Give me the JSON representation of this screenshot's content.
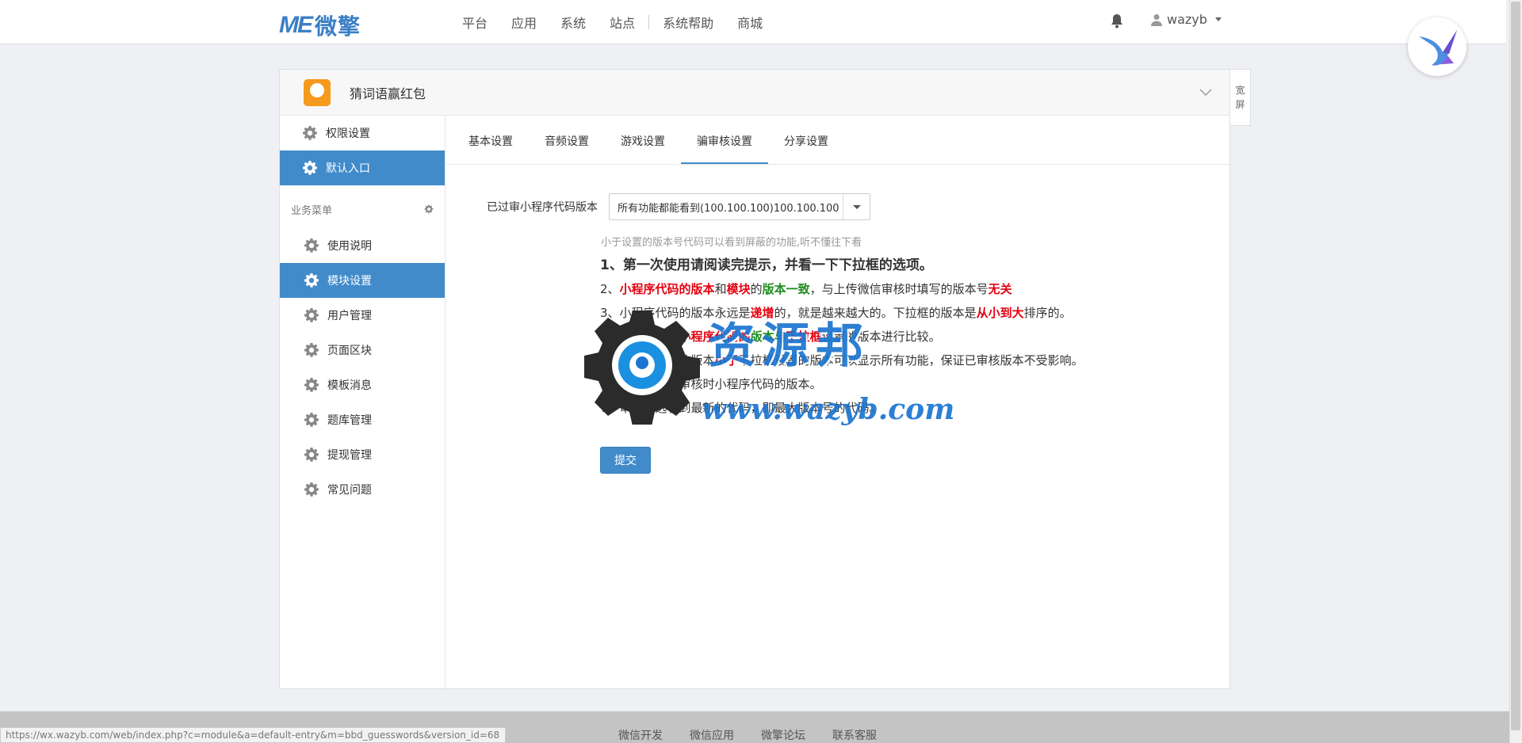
{
  "navbar": {
    "logo_mark": "ME",
    "logo_text": "微擎",
    "links": [
      "平台",
      "应用",
      "系统",
      "站点",
      "系统帮助",
      "商城"
    ],
    "user_name": "wazyb"
  },
  "panel": {
    "app_title": "猜词语赢红包",
    "wide_button": "宽屏"
  },
  "sidebar": {
    "top_items": [
      {
        "label": "权限设置",
        "active": false
      },
      {
        "label": "默认入口",
        "active": true
      }
    ],
    "section_title": "业务菜单",
    "items": [
      {
        "label": "使用说明",
        "active": false
      },
      {
        "label": "模块设置",
        "active": true
      },
      {
        "label": "用户管理",
        "active": false
      },
      {
        "label": "页面区块",
        "active": false
      },
      {
        "label": "模板消息",
        "active": false
      },
      {
        "label": "题库管理",
        "active": false
      },
      {
        "label": "提现管理",
        "active": false
      },
      {
        "label": "常见问题",
        "active": false
      }
    ]
  },
  "tabs": [
    {
      "label": "基本设置",
      "active": false
    },
    {
      "label": "音频设置",
      "active": false
    },
    {
      "label": "游戏设置",
      "active": false
    },
    {
      "label": "骗审核设置",
      "active": true
    },
    {
      "label": "分享设置",
      "active": false
    }
  ],
  "form": {
    "label": "已过审小程序代码版本",
    "select_value": "所有功能都能看到(100.100.100)100.100.100",
    "help": "小于设置的版本号代码可以看到屏蔽的功能,听不懂往下看",
    "submit": "提交"
  },
  "notes": {
    "n1": "1、第一次使用请阅读完提示，并看一下下拉框的选项。",
    "n2": [
      "2、",
      "小程序代码的版本",
      "和",
      "模块",
      "的",
      "版本一致",
      "，与上传微信审核时填写的版本号",
      "无关"
    ],
    "n3": [
      "3、小程序代码的版本永远是",
      "递增",
      "的，就是越来越大的。下拉框的版本是",
      "从小到大",
      "排序的。"
    ],
    "n4": [
      "4、",
      "骗审核",
      "是以",
      "小程序代码的",
      "版本与",
      "下拉框",
      "设置的版本进行比较。"
    ],
    "n5": [
      "5、小程序代码的版本",
      "小于",
      "下拉框设置的版本可以显示所有功能，保证已审核版本不受影响。"
    ],
    "n6": "6、请记住上传审核时小程序代码的版本。",
    "n7": "7、审核永远看到最新的代码，即最大版本号的代码。"
  },
  "watermark": {
    "cn": "资源邦",
    "url": "www.wazyb.com"
  },
  "footer": {
    "links": [
      "微信开发",
      "微信应用",
      "微擎论坛",
      "联系客服"
    ],
    "status_url": "https://wx.wazyb.com/web/index.php?c=module&a=default-entry&m=bbd_guesswords&version_id=68"
  },
  "colors": {
    "accent": "#428bca",
    "red": "#e4000f",
    "green": "#1f8c1f",
    "blue": "#2533d8",
    "watermark": "#1b75d0"
  }
}
